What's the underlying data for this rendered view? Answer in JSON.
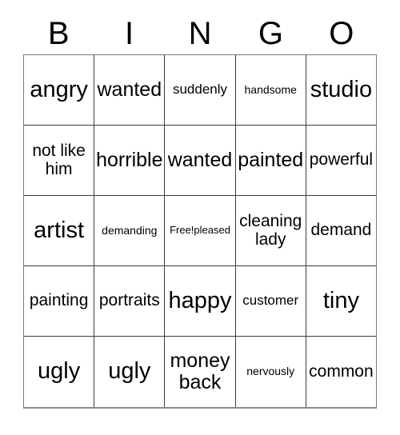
{
  "card": {
    "header_letters": [
      "B",
      "I",
      "N",
      "G",
      "O"
    ],
    "rows": [
      [
        {
          "text": "angry",
          "size": "fs-xl"
        },
        {
          "text": "wanted",
          "size": "fs-lg"
        },
        {
          "text": "suddenly",
          "size": "fs-sm"
        },
        {
          "text": "handsome",
          "size": "fs-xs"
        },
        {
          "text": "studio",
          "size": "fs-xl"
        }
      ],
      [
        {
          "text": "not like him",
          "size": "fs-md"
        },
        {
          "text": "horrible",
          "size": "fs-lg"
        },
        {
          "text": "wanted",
          "size": "fs-lg"
        },
        {
          "text": "painted",
          "size": "fs-lg"
        },
        {
          "text": "powerful",
          "size": "fs-md"
        }
      ],
      [
        {
          "text": "artist",
          "size": "fs-xl"
        },
        {
          "text": "demanding",
          "size": "fs-xs"
        },
        {
          "text": "Free!pleased",
          "size": "fs-xxs"
        },
        {
          "text": "cleaning lady",
          "size": "fs-md"
        },
        {
          "text": "demand",
          "size": "fs-md"
        }
      ],
      [
        {
          "text": "painting",
          "size": "fs-md"
        },
        {
          "text": "portraits",
          "size": "fs-md"
        },
        {
          "text": "happy",
          "size": "fs-xl"
        },
        {
          "text": "customer",
          "size": "fs-sm"
        },
        {
          "text": "tiny",
          "size": "fs-xl"
        }
      ],
      [
        {
          "text": "ugly",
          "size": "fs-xl"
        },
        {
          "text": "ugly",
          "size": "fs-xl"
        },
        {
          "text": "money back",
          "size": "fs-lg"
        },
        {
          "text": "nervously",
          "size": "fs-xs"
        },
        {
          "text": "common",
          "size": "fs-md"
        }
      ]
    ]
  }
}
